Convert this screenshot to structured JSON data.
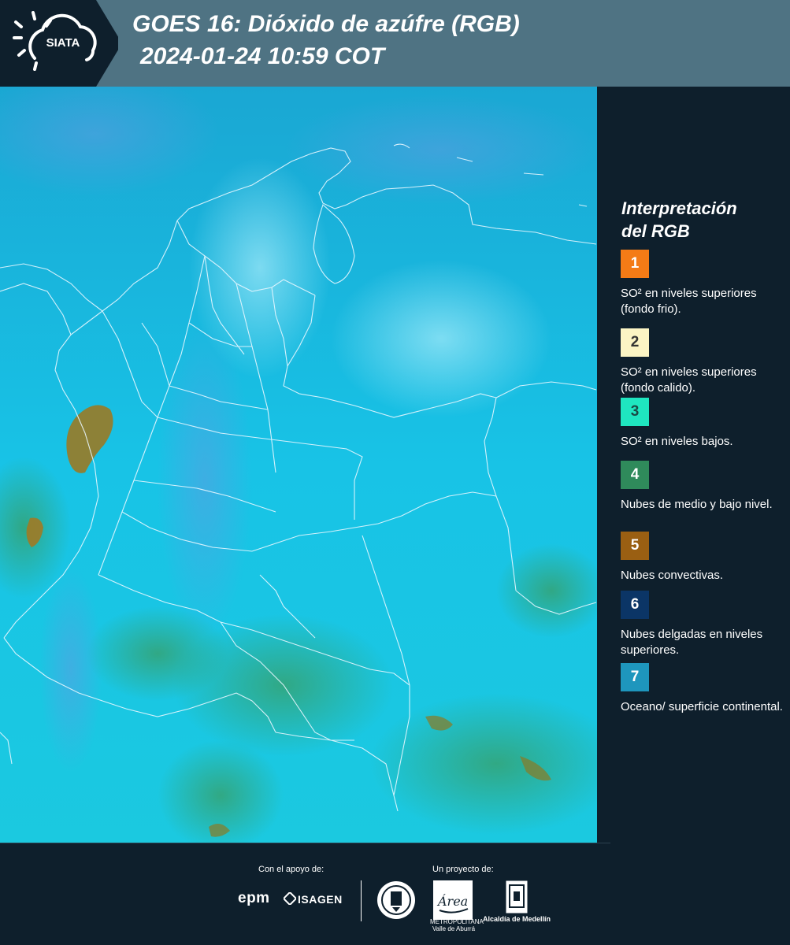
{
  "header": {
    "logo_text": "SIATA",
    "title_line1": "GOES 16: Dióxido de azúfre (RGB)",
    "title_line2": "2024-01-24 10:59 COT"
  },
  "legend": {
    "title_line1": "Interpretación",
    "title_line2": "del RGB",
    "items": [
      {
        "number": "1",
        "label": "SO² en niveles superiores (fondo frio).",
        "color": "#f47b16",
        "text_color": "#ffffff"
      },
      {
        "number": "2",
        "label": "SO² en niveles superiores (fondo calido).",
        "color": "#fbf4c4",
        "text_color": "#333333"
      },
      {
        "number": "3",
        "label": "SO² en niveles bajos.",
        "color": "#1fe6c0",
        "text_color": "#1a4a45"
      },
      {
        "number": "4",
        "label": "Nubes de medio y bajo nivel.",
        "color": "#2f8a5b",
        "text_color": "#ffffff"
      },
      {
        "number": "5",
        "label": "Nubes convectivas.",
        "color": "#9a5f12",
        "text_color": "#ffffff"
      },
      {
        "number": "6",
        "label": "Nubes delgadas en niveles superiores.",
        "color": "#0b3566",
        "text_color": "#ffffff"
      },
      {
        "number": "7",
        "label": "Oceano/ superficie continental.",
        "color": "#1e96bd",
        "text_color": "#ffffff"
      }
    ]
  },
  "footer": {
    "support_label": "Con el apoyo de:",
    "project_label": "Un proyecto de:",
    "sponsor_1": "epm",
    "sponsor_2": "ISAGEN",
    "partner_1_caption": "METROPOLITANA Valle de Aburrá",
    "partner_2_caption": "Alcaldía de Medellín",
    "partner_1_logo_text": "Área"
  },
  "map": {
    "ocean_color": "#1fb3d6",
    "land_color": "#1ad2ea",
    "border_color": "#e8f7ff"
  }
}
